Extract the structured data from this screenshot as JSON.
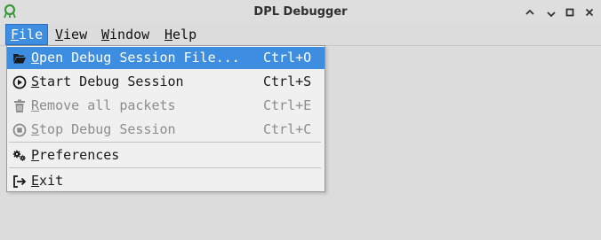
{
  "window": {
    "title": "DPL Debugger",
    "controls": [
      "up-arrow-icon",
      "minimize-icon",
      "maximize-icon",
      "close-icon"
    ]
  },
  "menubar": {
    "items": [
      {
        "label": "File",
        "mnemonic": "F",
        "rest": "ile",
        "active": true
      },
      {
        "label": "View",
        "mnemonic": "V",
        "rest": "iew",
        "active": false
      },
      {
        "label": "Window",
        "mnemonic": "W",
        "rest": "indow",
        "active": false
      },
      {
        "label": "Help",
        "mnemonic": "H",
        "rest": "elp",
        "active": false
      }
    ]
  },
  "file_menu": {
    "items": [
      {
        "icon": "folder-open-icon",
        "mnemonic": "O",
        "rest": "pen Debug Session File...",
        "shortcut": "Ctrl+O",
        "enabled": true,
        "highlighted": true
      },
      {
        "icon": "play-circle-icon",
        "mnemonic": "S",
        "rest": "tart Debug Session",
        "shortcut": "Ctrl+S",
        "enabled": true,
        "highlighted": false
      },
      {
        "icon": "trash-icon",
        "mnemonic": "R",
        "rest": "emove all packets",
        "shortcut": "Ctrl+E",
        "enabled": false,
        "highlighted": false
      },
      {
        "icon": "stop-circle-icon",
        "mnemonic": "S",
        "rest": "top Debug Session",
        "shortcut": "Ctrl+C",
        "enabled": false,
        "highlighted": false
      },
      {
        "icon": "gears-icon",
        "mnemonic": "P",
        "rest": "references",
        "shortcut": "",
        "enabled": true,
        "highlighted": false
      },
      {
        "icon": "exit-icon",
        "mnemonic": "E",
        "rest": "xit",
        "shortcut": "",
        "enabled": true,
        "highlighted": false
      }
    ]
  },
  "colors": {
    "highlight": "#3d8ee0",
    "menu_background": "#f0f0f0",
    "window_background": "#dcdcdc",
    "disabled_text": "#8c8c8c"
  }
}
